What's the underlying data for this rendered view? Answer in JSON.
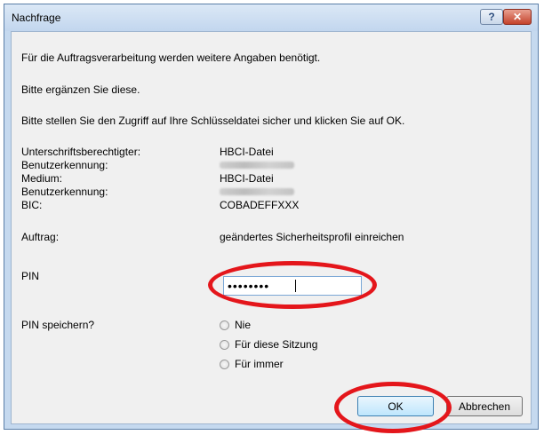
{
  "window": {
    "title": "Nachfrage",
    "help_label": "?",
    "close_label": "✕"
  },
  "messages": [
    "Für die Auftragsverarbeitung werden weitere Angaben benötigt.",
    "Bitte ergänzen Sie diese.",
    "Bitte stellen Sie den Zugriff auf Ihre Schlüsseldatei sicher und klicken Sie auf OK."
  ],
  "info": {
    "signatory_label": "Unterschriftsberechtigter:",
    "signatory_value": "HBCI-Datei",
    "user_id_label_1": "Benutzerkennung:",
    "medium_label": "Medium:",
    "medium_value": "HBCI-Datei",
    "user_id_label_2": "Benutzerkennung:",
    "bic_label": "BIC:",
    "bic_value": "COBADEFFXXX",
    "order_label": "Auftrag:",
    "order_value": "geändertes Sicherheitsprofil einreichen"
  },
  "pin": {
    "label": "PIN",
    "value": "••••••••"
  },
  "save_pin": {
    "label": "PIN speichern?",
    "options": [
      "Nie",
      "Für diese Sitzung",
      "Für immer"
    ]
  },
  "buttons": {
    "ok": "OK",
    "cancel": "Abbrechen"
  },
  "colors": {
    "highlight": "#e4161b",
    "titlebar": "#c5d9ef",
    "client_bg": "#f0f0f0"
  }
}
